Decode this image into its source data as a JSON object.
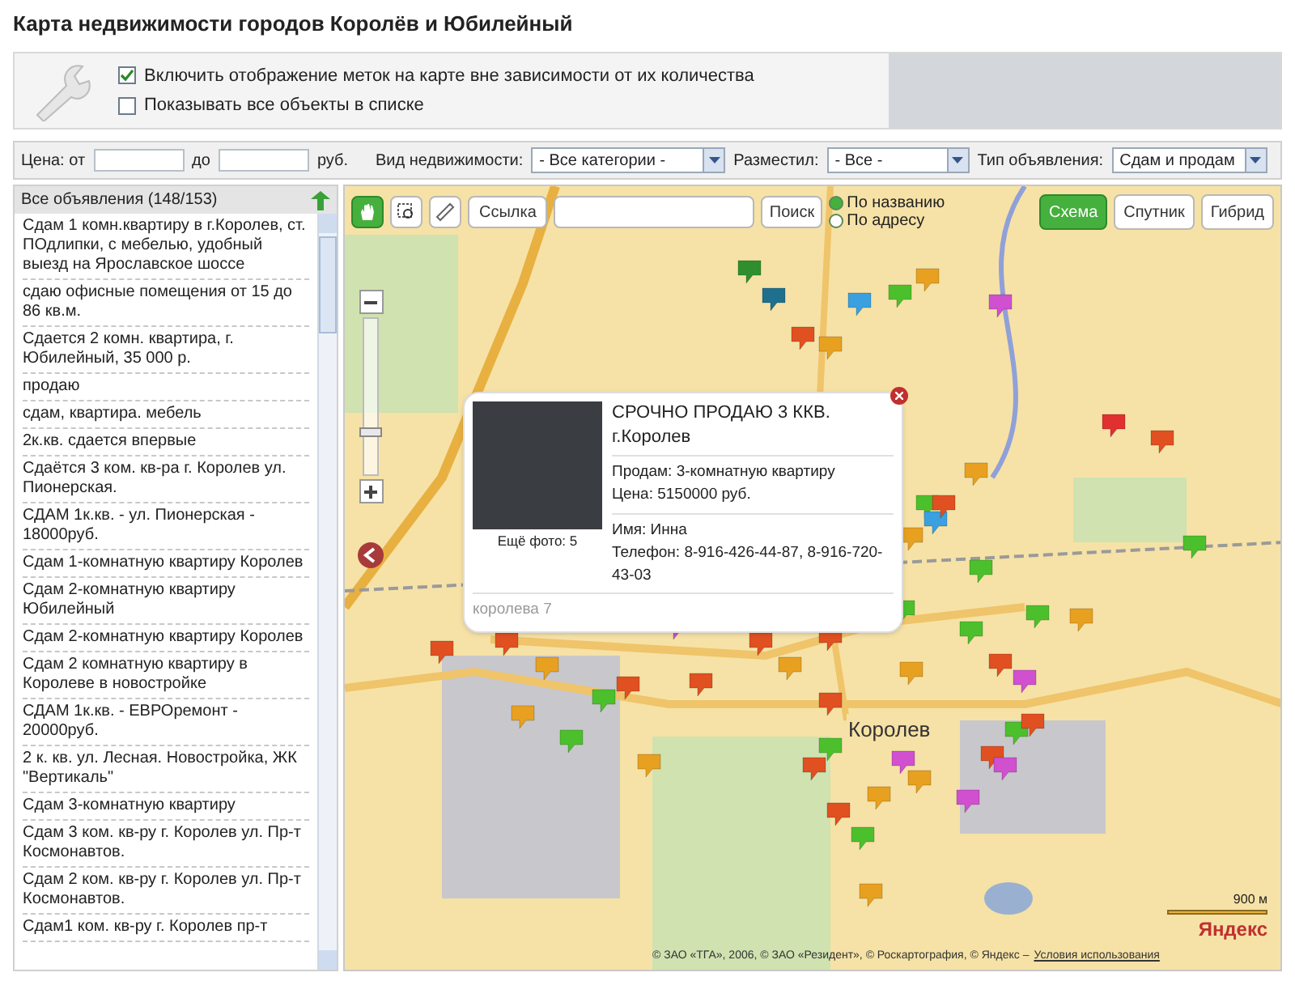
{
  "title": "Карта недвижимости городов Королёв и Юбилейный",
  "options": [
    {
      "label": "Включить отображение меток на карте вне зависимости от их количества",
      "checked": true
    },
    {
      "label": "Показывать все объекты в списке",
      "checked": false
    }
  ],
  "filters": {
    "price_label": "Цена: от",
    "price_to": "до",
    "currency": "руб.",
    "type_label": "Вид недвижимости:",
    "type_value": "- Все категории -",
    "poster_label": "Разместил:",
    "poster_value": "- Все -",
    "ad_type_label": "Тип объявления:",
    "ad_type_value": "Сдам и продам"
  },
  "sidebar": {
    "header": "Все объявления (148/153)",
    "items": [
      "Сдам 1 комн.квартиру в г.Королев, ст. ПОдлипки, с мебелью, удобный выезд на Ярославское шоссе",
      "сдаю офисные помещения от 15 до 86 кв.м.",
      "Сдается 2 комн. квартира, г. Юбилейный, 35 000 р.",
      "продаю",
      "сдам, квартира. мебель",
      "2к.кв. сдается впервые",
      "Сдаётся 3 ком. кв-ра г. Королев ул. Пионерская.",
      "СДАМ 1к.кв. - ул. Пионерская - 18000руб.",
      "Сдам 1-комнатную квартиру Королев",
      "Сдам 2-комнатную квартиру Юбилейный",
      "Сдам 2-комнатную квартиру Королев",
      "Сдам 2 комнатную квартиру в Королеве в новостройке",
      "СДАМ 1к.кв. - ЕВРОремонт - 20000руб.",
      "2 к. кв. ул. Лесная. Новостройка, ЖК \"Вертикаль\"",
      "Сдам 3-комнатную квартиру",
      "Сдам 3 ком. кв-ру г. Королев ул. Пр-т Космонавтов.",
      "Сдам 2 ком. кв-ру г. Королев ул. Пр-т Космонавтов.",
      "Сдам1 ком. кв-ру г. Королев пр-т"
    ]
  },
  "map": {
    "toolbar": {
      "link_button": "Ссылка",
      "search_button": "Поиск",
      "search_modes": [
        {
          "label": "По названию",
          "selected": true
        },
        {
          "label": "По адресу",
          "selected": false
        }
      ],
      "layers": [
        {
          "label": "Схема",
          "selected": true
        },
        {
          "label": "Спутник",
          "selected": false
        },
        {
          "label": "Гибрид",
          "selected": false
        }
      ]
    },
    "popup": {
      "title": "СРОЧНО ПРОДАЮ 3 ККВ. г.Королев",
      "more_photos": "Ещё фото: 5",
      "details": [
        "Продам: 3-комнатную квартиру",
        "Цена: 5150000 руб."
      ],
      "contact": [
        "Имя: Инна",
        "Телефон: 8-916-426-44-87, 8-916-720-43-03"
      ],
      "footer": "королева 7"
    },
    "zoom": {
      "level": 0.27
    },
    "city_label": "Королев",
    "scale": "900 м",
    "logo": "Яндекс",
    "copyright": "© ЗАО «ТГА», 2006, © ЗАО «Резидент», © Роскартография, © Яндекс –",
    "terms_link": "Условия использования"
  }
}
